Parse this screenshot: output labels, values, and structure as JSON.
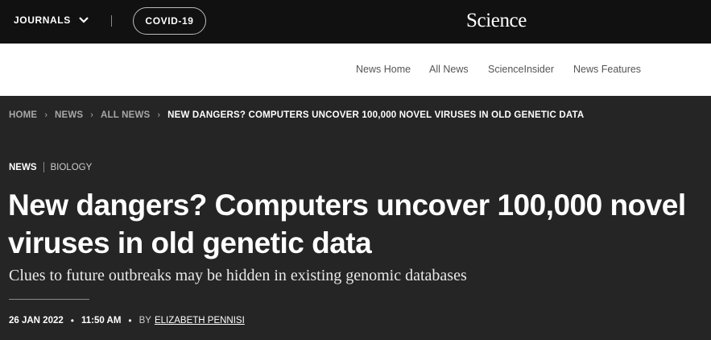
{
  "topbar": {
    "journals_label": "JOURNALS",
    "covid_label": "COVID-19",
    "logo_text": "Science"
  },
  "subnav": {
    "items": [
      "News Home",
      "All News",
      "ScienceInsider",
      "News Features"
    ]
  },
  "breadcrumb": {
    "items": [
      "HOME",
      "NEWS",
      "ALL NEWS"
    ],
    "current": "NEW DANGERS? COMPUTERS UNCOVER 100,000 NOVEL VIRUSES IN OLD GENETIC DATA"
  },
  "article": {
    "section": "NEWS",
    "topic": "BIOLOGY",
    "headline_line1": "New dangers? Computers uncover 100,000 novel",
    "headline_line2": "viruses in old genetic data",
    "dek": "Clues to future outbreaks may be hidden in existing genomic databases",
    "date": "26 JAN 2022",
    "time": "11:50 AM",
    "byline_prefix": "BY",
    "author": "ELIZABETH PENNISI"
  },
  "colors": {
    "topbar_bg": "#111111",
    "subnav_bg": "#ffffff",
    "article_bg": "#252525",
    "muted_text": "#a8a8a8"
  },
  "icons": {
    "journals_dropdown": "chevron-down-icon",
    "breadcrumb_separator": "chevron-right-icon"
  }
}
